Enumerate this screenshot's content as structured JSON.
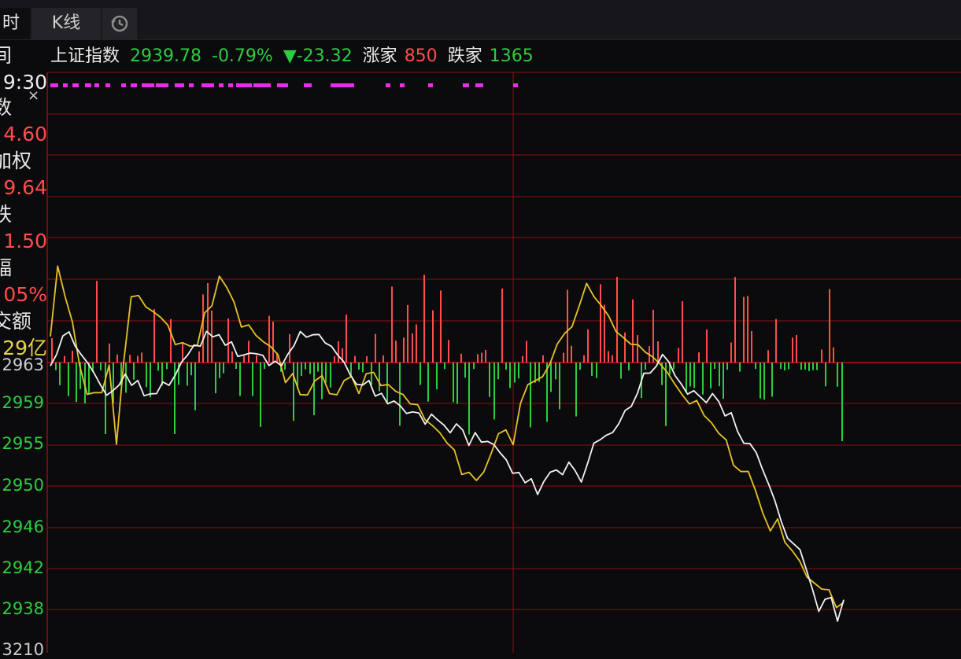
{
  "tabs": {
    "active_label": "时",
    "kline_label": "K线"
  },
  "header": {
    "index_name": "上证指数",
    "price": "2939.78",
    "change_pct": "-0.79%",
    "change_abs": "▼-23.32",
    "rise_label": "涨家",
    "rise_count": "850",
    "fall_label": "跌家",
    "fall_count": "1365"
  },
  "side_panel": {
    "close_symbol": "×",
    "rows": [
      {
        "text": "间",
        "kind": "lbl"
      },
      {
        "text": "9:30",
        "kind": "val-w"
      },
      {
        "text": "数",
        "kind": "lbl"
      },
      {
        "text": "4.60",
        "kind": "val-r"
      },
      {
        "text": "加权",
        "kind": "lbl"
      },
      {
        "text": "9.64",
        "kind": "val-r"
      },
      {
        "text": "跌",
        "kind": "lbl"
      },
      {
        "text": "1.50",
        "kind": "val-r"
      },
      {
        "text": "幅",
        "kind": "lbl"
      },
      {
        "text": "05%",
        "kind": "val-r"
      },
      {
        "text": "交额",
        "kind": "lbl"
      },
      {
        "text": "29亿",
        "kind": "val-y"
      }
    ]
  },
  "y_axis": {
    "top_partial": "2963",
    "ticks": [
      "2959",
      "2955",
      "2950",
      "2946",
      "2942",
      "2938"
    ],
    "bottom_partial": "3210"
  },
  "colors": {
    "grid": "#8a0f12",
    "white_line": "#f2f2f2",
    "yellow_line": "#e6c229",
    "up_bar": "#ff4c4c",
    "down_bar": "#2ecc40",
    "signal": "#e62ee6",
    "bg": "#0b0b0d"
  },
  "chart_data": {
    "type": "line",
    "y_range": [
      2936,
      2965
    ],
    "series": [
      {
        "values": [
          2963,
          2964,
          2966,
          2966,
          2965,
          2964,
          2963,
          2962,
          2961,
          2960,
          2960,
          2961,
          2962,
          2961,
          2961,
          2960,
          2960,
          2960,
          2961,
          2961,
          2962,
          2963,
          2964,
          2965,
          2965,
          2966,
          2966,
          2966,
          2965,
          2965,
          2964,
          2964,
          2964,
          2964,
          2964,
          2963,
          2963,
          2963,
          2964,
          2965,
          2966,
          2966,
          2966,
          2966,
          2965,
          2965,
          2964,
          2963,
          2962,
          2961,
          2961,
          2961,
          2960,
          2960,
          2959,
          2959,
          2959,
          2958,
          2958,
          2958,
          2957,
          2958,
          2957,
          2957,
          2956,
          2957,
          2956,
          2955,
          2956,
          2955,
          2955,
          2955,
          2954,
          2953,
          2952,
          2952,
          2951,
          2951,
          2950,
          2951,
          2952,
          2952,
          2952,
          2953,
          2952,
          2951,
          2953,
          2955,
          2955,
          2956,
          2956,
          2957,
          2958,
          2959,
          2960,
          2962,
          2962,
          2963,
          2964,
          2963,
          2962,
          2961,
          2960,
          2960,
          2960,
          2959,
          2960,
          2959,
          2958,
          2958,
          2956,
          2955,
          2955,
          2954,
          2952,
          2951,
          2949,
          2947,
          2945,
          2945,
          2944,
          2942,
          2940,
          2938,
          2939,
          2939,
          2937,
          2939
        ]
      },
      {
        "values": [
          2966,
          2973,
          2970,
          2967,
          2963,
          2960,
          2960,
          2960,
          2963,
          2955,
          2963,
          2970,
          2970,
          2969,
          2968,
          2968,
          2967,
          2965,
          2965,
          2965,
          2965,
          2968,
          2969,
          2972,
          2971,
          2969,
          2967,
          2967,
          2966,
          2965,
          2965,
          2964,
          2961,
          2962,
          2960,
          2960,
          2961,
          2962,
          2960,
          2960,
          2961,
          2962,
          2960,
          2962,
          2962,
          2961,
          2961,
          2960,
          2960,
          2959,
          2959,
          2957,
          2957,
          2956,
          2955,
          2954,
          2952,
          2952,
          2951,
          2952,
          2954,
          2956,
          2956,
          2955,
          2959,
          2961,
          2961,
          2962,
          2963,
          2965,
          2966,
          2967,
          2969,
          2971,
          2970,
          2969,
          2968,
          2966,
          2966,
          2965,
          2965,
          2964,
          2964,
          2963,
          2962,
          2961,
          2960,
          2959,
          2959,
          2958,
          2957,
          2956,
          2955,
          2953,
          2952,
          2952,
          2950,
          2948,
          2946,
          2947,
          2945,
          2944,
          2943,
          2941,
          2941,
          2940,
          2940,
          2938,
          2939
        ]
      }
    ]
  }
}
